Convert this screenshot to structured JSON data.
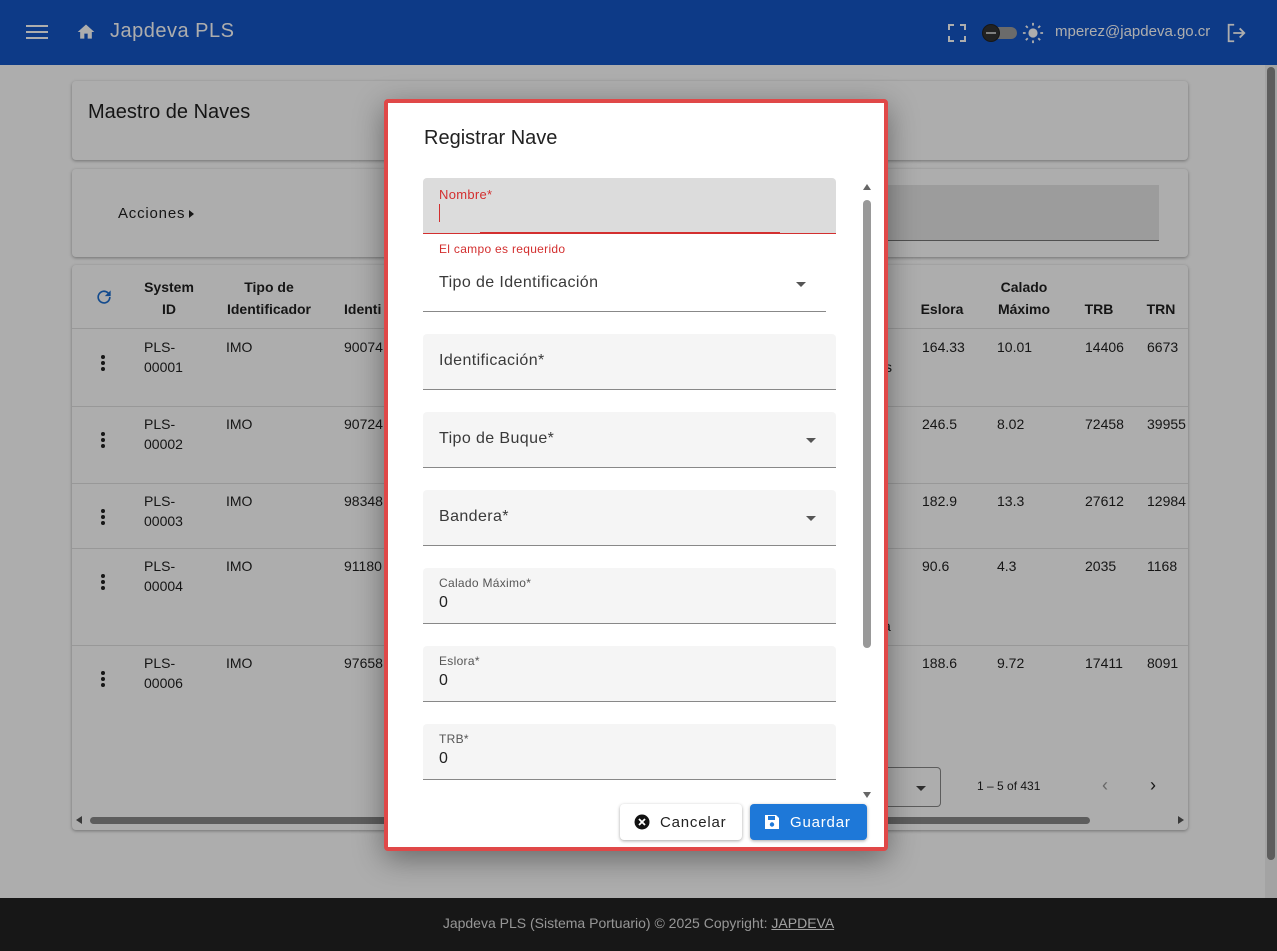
{
  "header": {
    "app_title": "Japdeva PLS",
    "user_email": "mperez@japdeva.go.cr"
  },
  "page": {
    "title": "Maestro de Naves",
    "actions_label": "Acciones"
  },
  "table": {
    "headers": {
      "system_id": [
        "System",
        "ID"
      ],
      "tipo_identificador": [
        "Tipo de",
        "Identificador"
      ],
      "identificacion": "Identi",
      "eslora": "Eslora",
      "calado_maximo": [
        "Calado",
        "Máximo"
      ],
      "trb": "TRB",
      "trn": "TRN"
    },
    "rows": [
      {
        "system_id": [
          "PLS-",
          "00001"
        ],
        "tipo": "IMO",
        "ident": "90074",
        "eslora": "164.33",
        "calado": "10.01",
        "trb": "14406",
        "trn": "6673",
        "extra": "s"
      },
      {
        "system_id": [
          "PLS-",
          "00002"
        ],
        "tipo": "IMO",
        "ident": "90724",
        "eslora": "246.5",
        "calado": "8.02",
        "trb": "72458",
        "trn": "39955",
        "extra": ""
      },
      {
        "system_id": [
          "PLS-",
          "00003"
        ],
        "tipo": "IMO",
        "ident": "98348",
        "eslora": "182.9",
        "calado": "13.3",
        "trb": "27612",
        "trn": "12984",
        "extra": ""
      },
      {
        "system_id": [
          "PLS-",
          "00004"
        ],
        "tipo": "IMO",
        "ident": "91180",
        "eslora": "90.6",
        "calado": "4.3",
        "trb": "2035",
        "trn": "1168",
        "extra": "a"
      },
      {
        "system_id": [
          "PLS-",
          "00006"
        ],
        "tipo": "IMO",
        "ident": "97658",
        "eslora": "188.6",
        "calado": "9.72",
        "trb": "17411",
        "trn": "8091",
        "extra": ""
      }
    ]
  },
  "paginator": {
    "range": "1 – 5 of 431"
  },
  "footer": {
    "text": "Japdeva PLS (Sistema Portuario) © 2025 Copyright: ",
    "link": "JAPDEVA"
  },
  "dialog": {
    "title": "Registrar Nave",
    "fields": {
      "nombre": {
        "label": "Nombre*",
        "error": "El campo es requerido"
      },
      "tipo_identificacion": {
        "label": "Tipo de Identificación"
      },
      "identificacion": {
        "label": "Identificación*"
      },
      "tipo_buque": {
        "label": "Tipo de Buque*"
      },
      "bandera": {
        "label": "Bandera*"
      },
      "calado_maximo": {
        "label": "Calado Máximo*",
        "value": "0"
      },
      "eslora": {
        "label": "Eslora*",
        "value": "0"
      },
      "trb": {
        "label": "TRB*",
        "value": "0"
      }
    },
    "cancel_label": "Cancelar",
    "save_label": "Guardar"
  },
  "colors": {
    "topbar": "#1456c8",
    "primary_button": "#1e78d8",
    "error": "#d32f2f",
    "dialog_border": "#e04848"
  }
}
